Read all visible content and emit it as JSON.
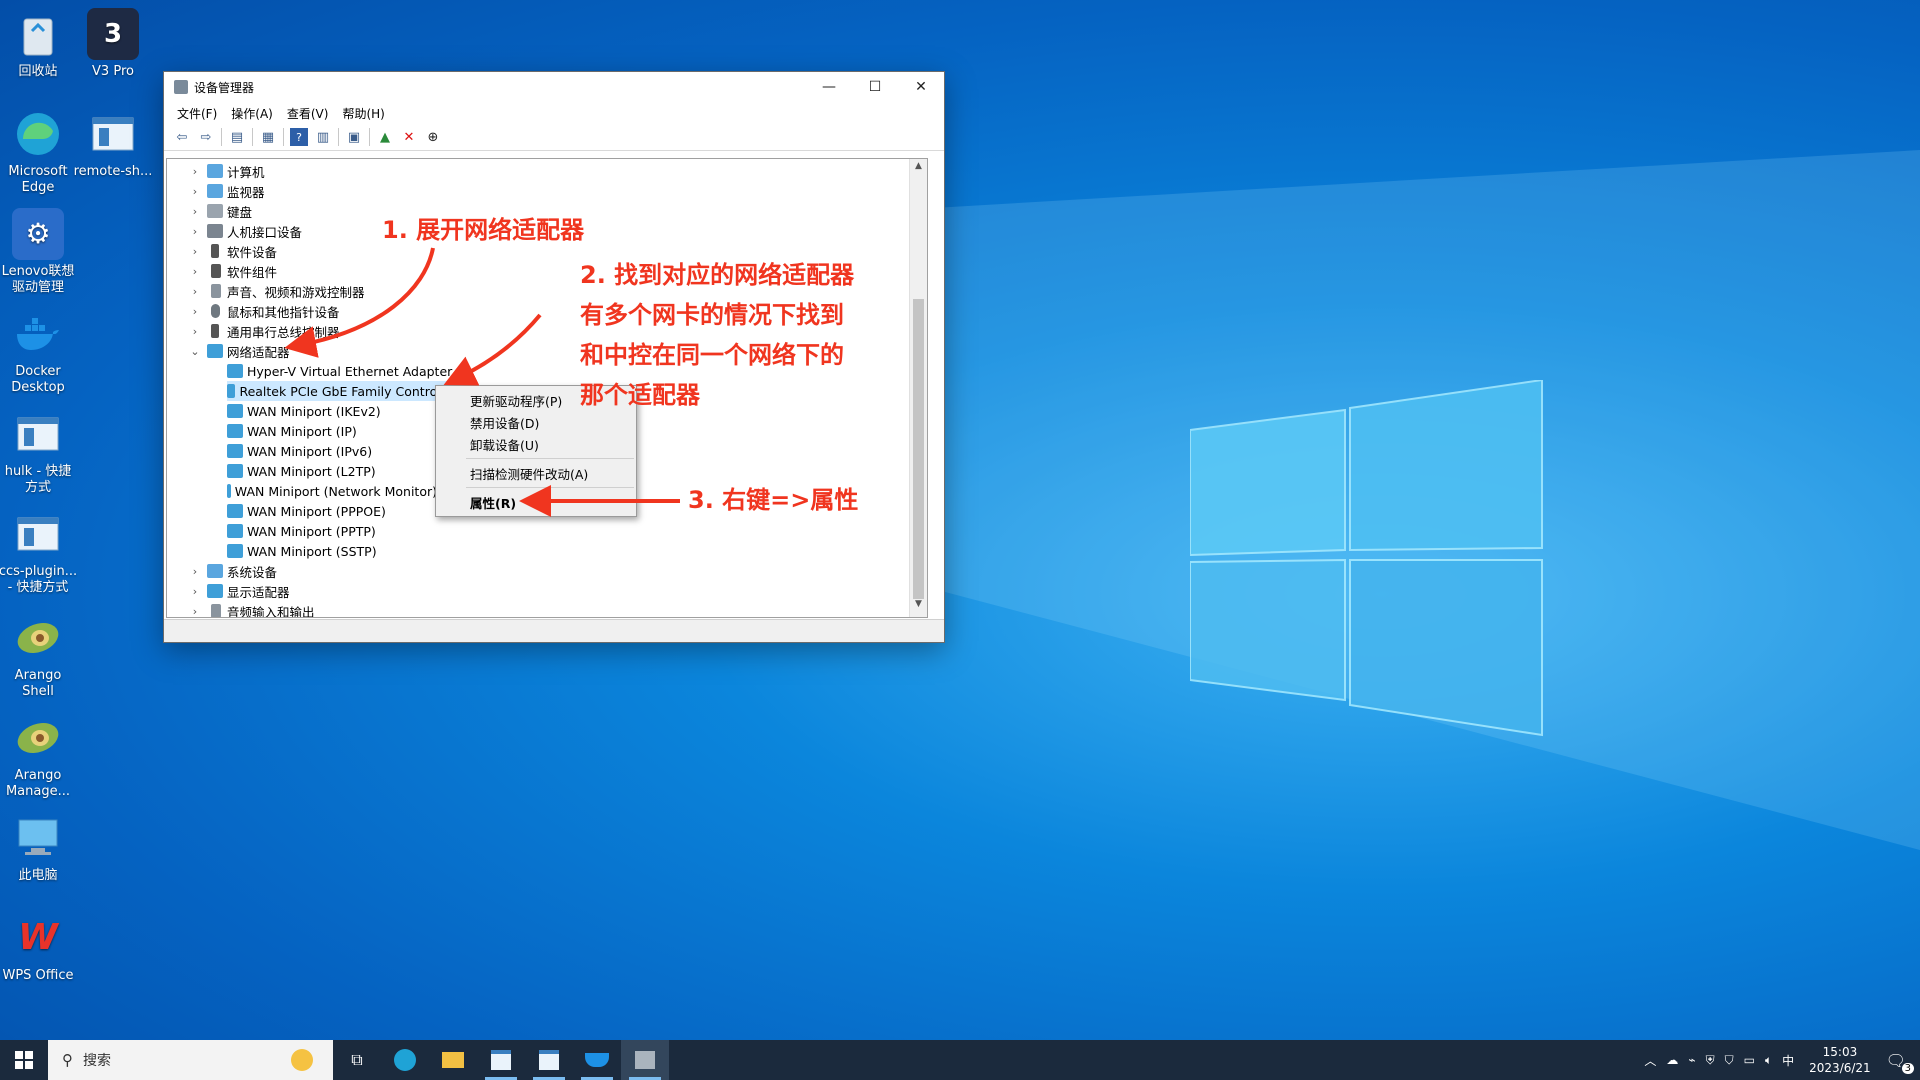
{
  "desktop": {
    "icons": [
      {
        "label": "回收站"
      },
      {
        "label": "V3 Pro"
      },
      {
        "label": "Microsoft\nEdge"
      },
      {
        "label": "remote-sh..."
      },
      {
        "label": "Lenovo联想\n驱动管理"
      },
      {
        "label": "Docker\nDesktop"
      },
      {
        "label": "hulk - 快捷\n方式"
      },
      {
        "label": "ccs-plugin...\n- 快捷方式"
      },
      {
        "label": "Arango\nShell"
      },
      {
        "label": "Arango\nManage..."
      },
      {
        "label": "此电脑"
      },
      {
        "label": "WPS Office"
      }
    ]
  },
  "window": {
    "title": "设备管理器",
    "menu": [
      "文件(F)",
      "操作(A)",
      "查看(V)",
      "帮助(H)"
    ],
    "tree": [
      {
        "label": "计算机",
        "expanded": false
      },
      {
        "label": "监视器",
        "expanded": false
      },
      {
        "label": "键盘",
        "expanded": false
      },
      {
        "label": "人机接口设备",
        "expanded": false
      },
      {
        "label": "软件设备",
        "expanded": false
      },
      {
        "label": "软件组件",
        "expanded": false
      },
      {
        "label": "声音、视频和游戏控制器",
        "expanded": false
      },
      {
        "label": "鼠标和其他指针设备",
        "expanded": false
      },
      {
        "label": "通用串行总线控制器",
        "expanded": false
      },
      {
        "label": "网络适配器",
        "expanded": true
      },
      {
        "label": "系统设备",
        "expanded": false
      },
      {
        "label": "显示适配器",
        "expanded": false
      },
      {
        "label": "音频输入和输出",
        "expanded": false
      }
    ],
    "network_children": [
      "Hyper-V Virtual Ethernet Adapter",
      "Realtek PCIe GbE Family Controller",
      "WAN Miniport (IKEv2)",
      "WAN Miniport (IP)",
      "WAN Miniport (IPv6)",
      "WAN Miniport (L2TP)",
      "WAN Miniport (Network Monitor)",
      "WAN Miniport (PPPOE)",
      "WAN Miniport (PPTP)",
      "WAN Miniport (SSTP)"
    ],
    "selected_child": "Realtek PCIe GbE Family Controller"
  },
  "context_menu": {
    "items": [
      "更新驱动程序(P)",
      "禁用设备(D)",
      "卸载设备(U)",
      "扫描检测硬件改动(A)",
      "属性(R)"
    ]
  },
  "annotations": {
    "step1": "1. 展开网络适配器",
    "step2": "2. 找到对应的网络适配器\n    有多个网卡的情况下找到\n    和中控在同一个网络下的\n    那个适配器",
    "step3": "3. 右键=>属性"
  },
  "taskbar": {
    "search_placeholder": "搜索",
    "clock_time": "15:03",
    "clock_date": "2023/6/21",
    "ime": "中",
    "notification_count": "3"
  },
  "colors": {
    "annotation": "#f0351f",
    "selection": "#cce8ff",
    "taskbar": "#1b2a3d"
  }
}
